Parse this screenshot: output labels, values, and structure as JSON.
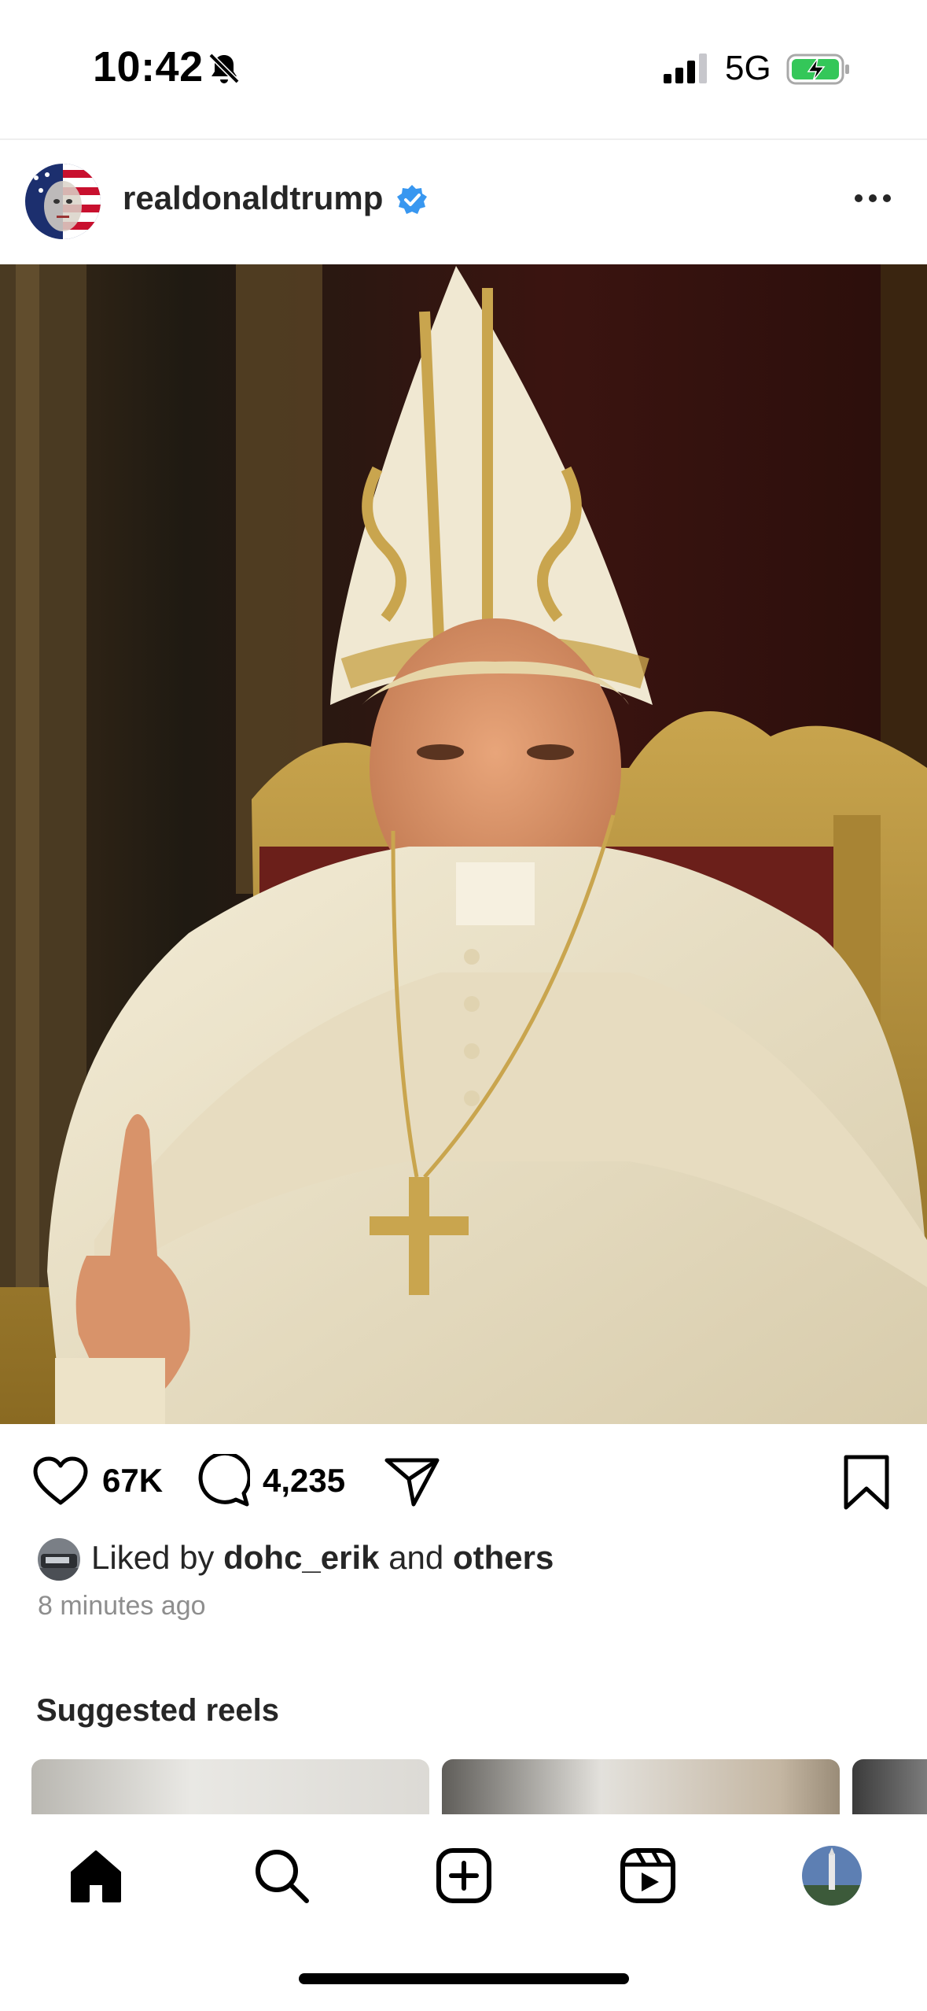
{
  "status_bar": {
    "time": "10:42",
    "network": "5G",
    "icons": [
      "bell-slash-icon",
      "signal-icon",
      "battery-charging-icon"
    ]
  },
  "post": {
    "username": "realdonaldtrump",
    "verified": true,
    "likes_count": "67K",
    "comments_count": "4,235",
    "liked_by_prefix": "Liked by ",
    "liked_by_user": "dohc_erik",
    "liked_by_and": " and ",
    "liked_by_others": "others",
    "timestamp": "8 minutes ago"
  },
  "suggested": {
    "title": "Suggested reels"
  },
  "nav": {
    "items": [
      "home-icon",
      "search-icon",
      "create-icon",
      "reels-icon",
      "profile-avatar"
    ]
  },
  "colors": {
    "verified_blue": "#3897f0",
    "battery_green": "#34c759",
    "secondary_text": "#8e8e8e"
  }
}
